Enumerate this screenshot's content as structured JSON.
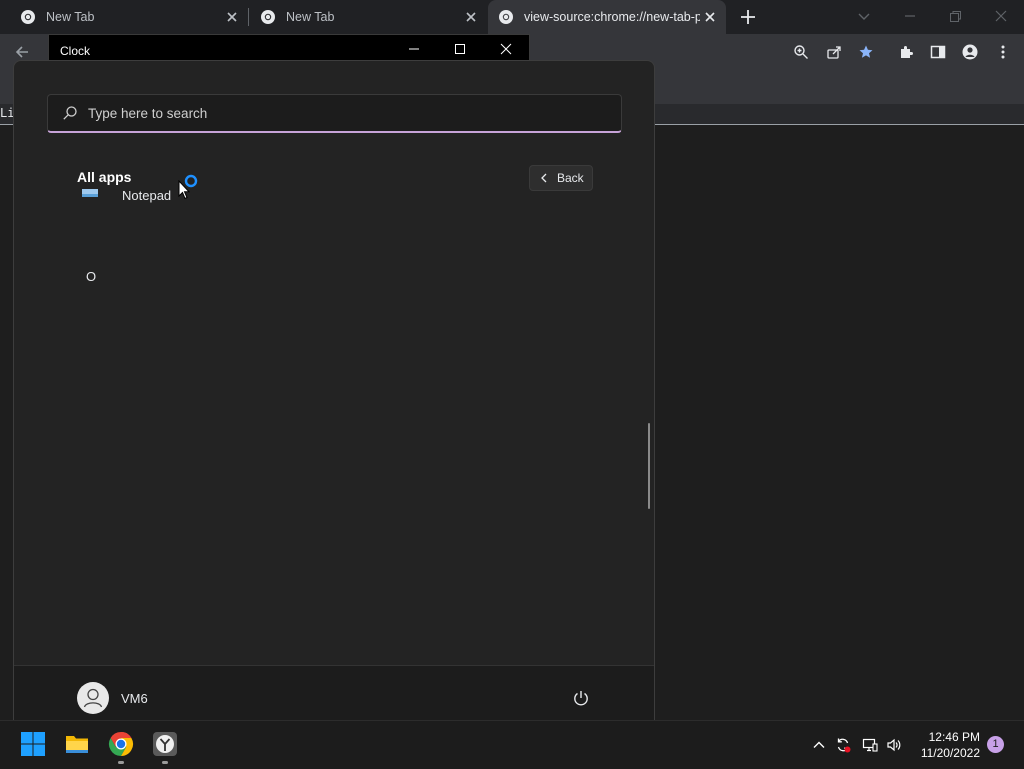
{
  "browser": {
    "tabs": [
      {
        "title": "New Tab"
      },
      {
        "title": "New Tab"
      },
      {
        "title": "view-source:chrome://new-tab-p"
      }
    ],
    "source_text": "Li"
  },
  "clock_window": {
    "title": "Clock"
  },
  "start_menu": {
    "search_placeholder": "Type here to search",
    "all_apps_label": "All apps",
    "back_label": "Back",
    "partial_app": "Notepad",
    "letter_header": "O",
    "user_name": "VM6"
  },
  "taskbar": {
    "apps": [
      "windows-start-icon",
      "file-explorer-icon",
      "chrome-icon",
      "clock-app-icon"
    ],
    "time": "12:46 PM",
    "date": "11/20/2022",
    "notification_count": "1"
  },
  "colors": {
    "accent": "#0078d4",
    "search_underline": "#c7a3d8",
    "notification_badge": "#c8a1e8",
    "bookmark_star": "#8ab4f8"
  }
}
